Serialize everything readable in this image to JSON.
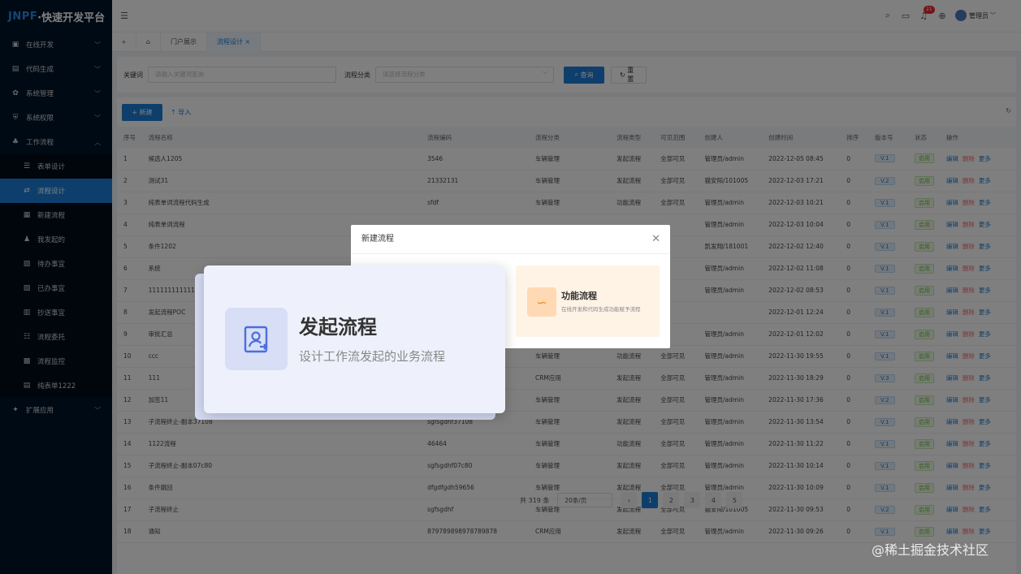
{
  "app": {
    "logo_brand": "JNPF",
    "logo_text": "·快速开发平台"
  },
  "sidebar": {
    "items": [
      {
        "label": "在线开发",
        "icon": "monitor-icon",
        "sub": false,
        "active": false,
        "chev": "﹀"
      },
      {
        "label": "代码生成",
        "icon": "code-icon",
        "sub": false,
        "active": false,
        "chev": "﹀"
      },
      {
        "label": "系统管理",
        "icon": "gear-icon",
        "sub": false,
        "active": false,
        "chev": "﹀"
      },
      {
        "label": "系统权限",
        "icon": "shield-icon",
        "sub": false,
        "active": false,
        "chev": "﹀"
      },
      {
        "label": "工作流程",
        "icon": "flow-icon",
        "sub": false,
        "active": false,
        "chev": "︿"
      },
      {
        "label": "表单设计",
        "icon": "table-icon",
        "sub": true,
        "active": false
      },
      {
        "label": "流程设计",
        "icon": "design-icon",
        "sub": true,
        "active": true
      },
      {
        "label": "新建流程",
        "icon": "new-icon",
        "sub": true,
        "active": false
      },
      {
        "label": "我发起的",
        "icon": "user-icon",
        "sub": true,
        "active": false
      },
      {
        "label": "待办事宜",
        "icon": "todo-icon",
        "sub": true,
        "active": false
      },
      {
        "label": "已办事宜",
        "icon": "done-icon",
        "sub": true,
        "active": false
      },
      {
        "label": "抄送事宜",
        "icon": "cc-icon",
        "sub": true,
        "active": false
      },
      {
        "label": "流程委托",
        "icon": "delegate-icon",
        "sub": true,
        "active": false
      },
      {
        "label": "流程监控",
        "icon": "monitor-flow-icon",
        "sub": true,
        "active": false
      },
      {
        "label": "纯表单1222",
        "icon": "form-icon",
        "sub": true,
        "active": false
      },
      {
        "label": "扩展应用",
        "icon": "apps-icon",
        "sub": false,
        "active": false,
        "chev": "﹀"
      }
    ]
  },
  "topbar": {
    "badge": "21",
    "user": "管理员"
  },
  "tabs": {
    "home": "门户展示",
    "active": "流程设计"
  },
  "search": {
    "keyword_label": "关键词",
    "keyword_placeholder": "请输入关键词查询",
    "category_label": "流程分类",
    "category_placeholder": "请选择流程分类",
    "query": "查询",
    "reset": "重置"
  },
  "toolbar": {
    "new": "新建",
    "import": "导入"
  },
  "table": {
    "headers": [
      "序号",
      "流程名称",
      "流程编码",
      "流程分类",
      "流程类型",
      "可见范围",
      "创建人",
      "创建时间",
      "排序",
      "版本号",
      "状态",
      "操作"
    ],
    "rows": [
      [
        "1",
        "候选人1205",
        "3546",
        "车辆管理",
        "发起流程",
        "全部可见",
        "管理员/admin",
        "2022-12-05 08:45",
        "0",
        "V.1",
        "启用"
      ],
      [
        "2",
        "测试31",
        "21332131",
        "车辆管理",
        "发起流程",
        "全部可见",
        "猫安阳/101005",
        "2022-12-03 17:21",
        "0",
        "V.2",
        "启用"
      ],
      [
        "3",
        "纯表单词流程代码生成",
        "sfdf",
        "车辆管理",
        "功能流程",
        "全部可见",
        "管理员/admin",
        "2022-12-03 10:21",
        "0",
        "V.1",
        "启用"
      ],
      [
        "4",
        "纯表单词流程",
        "",
        "",
        "",
        "",
        "管理员/admin",
        "2022-12-03 10:04",
        "0",
        "V.1",
        "启用"
      ],
      [
        "5",
        "条件1202",
        "",
        "",
        "",
        "",
        "凯发翔/181001",
        "2022-12-02 12:40",
        "0",
        "V.1",
        "启用"
      ],
      [
        "6",
        "系统",
        "",
        "",
        "",
        "",
        "管理员/admin",
        "2022-12-02 11:08",
        "0",
        "V.1",
        "启用"
      ],
      [
        "7",
        "1111111111111",
        "",
        "",
        "",
        "",
        "管理员/admin",
        "2022-12-02 08:53",
        "0",
        "V.1",
        "启用"
      ],
      [
        "8",
        "发起流程POC",
        "",
        "",
        "",
        "",
        "",
        "2022-12-01 12:24",
        "0",
        "V.1",
        "启用"
      ],
      [
        "9",
        "审批汇总",
        "",
        "",
        "",
        "",
        "管理员/admin",
        "2022-12-01 12:02",
        "0",
        "V.1",
        "启用"
      ],
      [
        "10",
        "ccc",
        "",
        "车辆管理",
        "功能流程",
        "全部可见",
        "管理员/admin",
        "2022-11-30 19:55",
        "0",
        "V.1",
        "启用"
      ],
      [
        "11",
        "111",
        "",
        "CRM应用",
        "发起流程",
        "全部可见",
        "管理员/admin",
        "2022-11-30 18:29",
        "0",
        "V.3",
        "启用"
      ],
      [
        "12",
        "加签11",
        "",
        "车辆管理",
        "发起流程",
        "全部可见",
        "管理员/admin",
        "2022-11-30 17:36",
        "0",
        "V.2",
        "启用"
      ],
      [
        "13",
        "子流程终止-副本37108",
        "sgfsgdhf37108",
        "车辆管理",
        "发起流程",
        "全部可见",
        "管理员/admin",
        "2022-11-30 13:54",
        "0",
        "V.1",
        "启用"
      ],
      [
        "14",
        "1122流程",
        "46464",
        "车辆管理",
        "功能流程",
        "全部可见",
        "管理员/admin",
        "2022-11-30 11:22",
        "0",
        "V.1",
        "启用"
      ],
      [
        "15",
        "子流程终止-副本07c80",
        "sgfsgdhf07c80",
        "车辆管理",
        "发起流程",
        "全部可见",
        "管理员/admin",
        "2022-11-30 10:14",
        "0",
        "V.1",
        "启用"
      ],
      [
        "16",
        "条件跳回",
        "dfgdfgdh59656",
        "车辆管理",
        "发起流程",
        "全部可见",
        "管理员/admin",
        "2022-11-30 10:09",
        "0",
        "V.1",
        "启用"
      ],
      [
        "17",
        "子流程终止",
        "sgfsgdhf",
        "车辆管理",
        "发起流程",
        "全部可见",
        "猫安阳/101005",
        "2022-11-30 09:53",
        "0",
        "V.2",
        "启用"
      ],
      [
        "18",
        "通知",
        "879789898978789878",
        "CRM应用",
        "发起流程",
        "全部可见",
        "管理员/admin",
        "2022-11-30 09:26",
        "0",
        "V.1",
        "启用"
      ]
    ],
    "op_edit": "编辑",
    "op_del": "删除",
    "op_more": "更多"
  },
  "pager": {
    "total": "共 319 条",
    "size": "20条/页",
    "pages": [
      "1",
      "2",
      "3",
      "4",
      "5"
    ]
  },
  "dialog": {
    "title": "新建流程",
    "option1_title": "发起流程",
    "option1_desc": "设计工作流发起的业务流程",
    "option2_title": "功能流程",
    "option2_desc": "在线开发和代码生成功能赋予流程"
  },
  "watermark": "@稀土掘金技术社区"
}
